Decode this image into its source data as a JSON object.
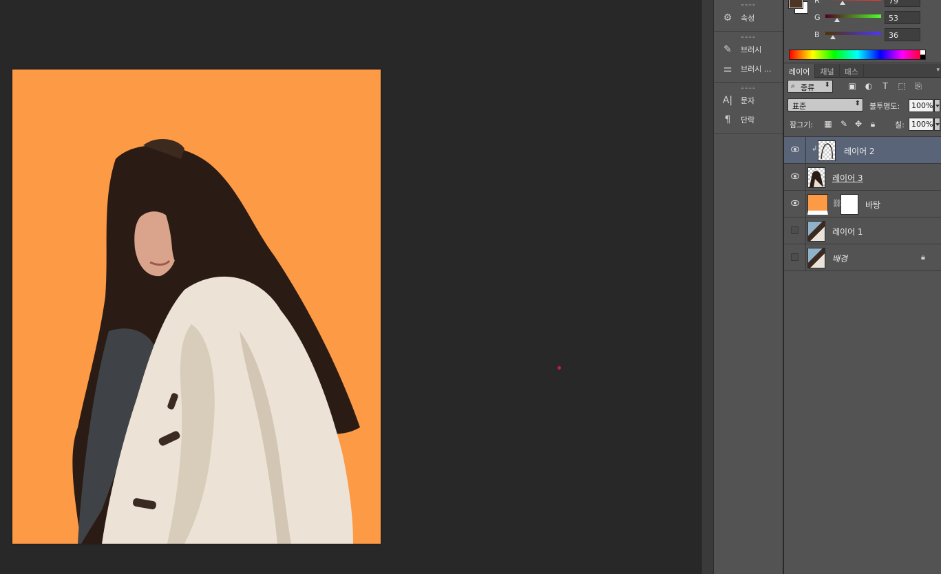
{
  "dock": {
    "groups": [
      [
        {
          "label": "속성",
          "icon": "properties-icon"
        }
      ],
      [
        {
          "label": "브러시",
          "icon": "brush-icon"
        },
        {
          "label": "브러시 ...",
          "icon": "brush-presets-icon"
        }
      ],
      [
        {
          "label": "문자",
          "icon": "character-icon"
        },
        {
          "label": "단락",
          "icon": "paragraph-icon"
        }
      ]
    ]
  },
  "color_panel": {
    "foreground": "#4f3524",
    "background": "#ffffff",
    "channels": [
      {
        "label": "R",
        "value": "79",
        "fraction": 0.31
      },
      {
        "label": "G",
        "value": "53",
        "fraction": 0.21
      },
      {
        "label": "B",
        "value": "36",
        "fraction": 0.14
      }
    ]
  },
  "layers_panel": {
    "tabs": [
      "레이어",
      "채널",
      "패스"
    ],
    "active_tab": "레이어",
    "filter_select": "종류",
    "blend_mode": "표준",
    "opacity_label": "불투명도:",
    "opacity_value": "100%",
    "lock_label": "잠그기:",
    "fill_label": "칠:",
    "fill_value": "100%",
    "layers": [
      {
        "name": "레이어 2",
        "visible": true,
        "selected": true,
        "clipped": true
      },
      {
        "name": "레이어 3",
        "visible": true,
        "selected": false
      },
      {
        "name": "바탕",
        "visible": true,
        "selected": false,
        "has_mask": true
      },
      {
        "name": "레이어 1",
        "visible": false,
        "selected": false
      },
      {
        "name": "배경",
        "visible": false,
        "selected": false,
        "locked": true
      }
    ]
  },
  "document": {
    "background_color": "#fd9a45"
  }
}
